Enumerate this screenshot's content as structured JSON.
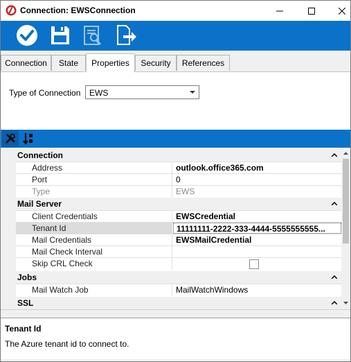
{
  "window": {
    "title": "Connection: EWSConnection"
  },
  "toolbar": {
    "buttons": [
      {
        "name": "apply",
        "icon": "check-circle-icon"
      },
      {
        "name": "save",
        "icon": "floppy-disk-icon"
      },
      {
        "name": "preview",
        "icon": "document-search-icon"
      },
      {
        "name": "export",
        "icon": "document-export-icon"
      }
    ]
  },
  "tabs": [
    "Connection",
    "State",
    "Properties",
    "Security",
    "References"
  ],
  "active_tab": "Properties",
  "type_of_connection": {
    "label": "Type of Connection",
    "value": "EWS"
  },
  "grid": {
    "categories": [
      {
        "label": "Connection"
      },
      {
        "label": "Mail Server"
      },
      {
        "label": "Jobs"
      },
      {
        "label": "SSL"
      }
    ],
    "rows": {
      "address": {
        "name": "Address",
        "value": "outlook.office365.com"
      },
      "port": {
        "name": "Port",
        "value": "0"
      },
      "type": {
        "name": "Type",
        "value": "EWS"
      },
      "client_credentials": {
        "name": "Client Credentials",
        "value": "EWSCredential"
      },
      "tenant_id": {
        "name": "Tenant Id",
        "value": "11111111-2222-333-4444-5555555555..."
      },
      "mail_credentials": {
        "name": "Mail Credentials",
        "value": "EWSMailCredential"
      },
      "mail_check_interval": {
        "name": "Mail Check Interval",
        "value": ""
      },
      "skip_crl_check": {
        "name": "Skip CRL Check",
        "checked": false
      },
      "mail_watch_job": {
        "name": "Mail Watch Job",
        "value": "MailWatchWindows"
      }
    }
  },
  "help": {
    "title": "Tenant Id",
    "description": "The Azure tenant id to connect to."
  },
  "colors": {
    "accent": "#0a72c8",
    "panel": "#f0f0f0"
  }
}
